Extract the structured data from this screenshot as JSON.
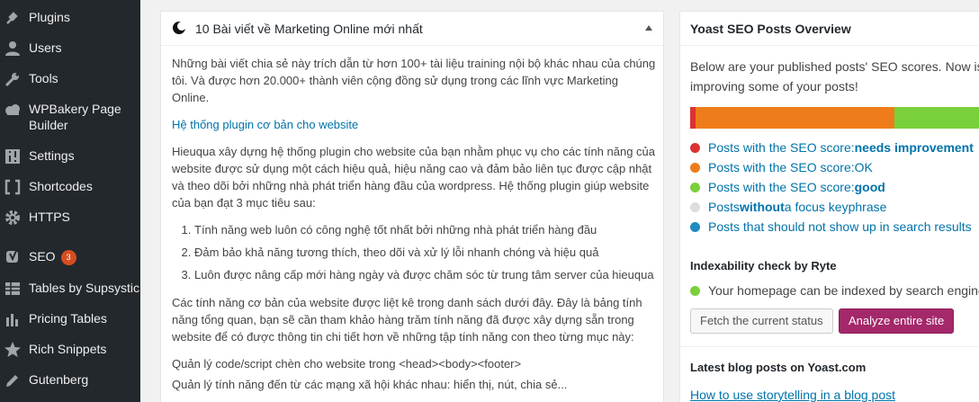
{
  "sidebar": {
    "items": [
      {
        "label": "Plugins",
        "icon": "plug-icon"
      },
      {
        "label": "Users",
        "icon": "user-icon"
      },
      {
        "label": "Tools",
        "icon": "wrench-icon"
      },
      {
        "label": "WPBakery Page Builder",
        "icon": "cloud-icon"
      },
      {
        "label": "Settings",
        "icon": "settings-icon"
      },
      {
        "label": "Shortcodes",
        "icon": "brackets-icon"
      },
      {
        "label": "HTTPS",
        "icon": "gear-icon"
      },
      {
        "label": "SEO",
        "icon": "yoast-icon",
        "badge": "3"
      },
      {
        "label": "Tables by Supsystic",
        "icon": "table-icon"
      },
      {
        "label": "Pricing Tables",
        "icon": "bar-chart-icon"
      },
      {
        "label": "Rich Snippets",
        "icon": "star-icon"
      },
      {
        "label": "Gutenberg",
        "icon": "pencil-icon"
      }
    ]
  },
  "marketing_panel": {
    "title": "10 Bài viết về Marketing Online mới nhất",
    "intro": "Những bài viết chia sẻ này trích dẫn từ hơn 100+ tài liệu training nội bộ khác nhau của chúng tôi. Và được hơn 20.000+ thành viên cộng đồng sử dụng trong các lĩnh vực Marketing Online.",
    "link": "Hệ thống plugin cơ bản cho website",
    "para2": "Hieuqua xây dựng hệ thống plugin cho website của bạn nhằm phục vụ cho các tính năng của website được sử dụng một cách hiệu quả, hiệu năng cao và đảm bảo liên tục được cập nhật và theo dõi bởi những nhà phát triển hàng đầu của wordpress. Hệ thống plugin giúp website của bạn đạt 3 mục tiêu sau:",
    "list": [
      "Tính năng web luôn có công nghệ tốt nhất bởi những nhà phát triển hàng đầu",
      "Đảm bảo khả năng tương thích, theo dõi và xử lý lỗi nhanh chóng và hiệu quả",
      "Luôn được nâng cấp mới hàng ngày và được chăm sóc từ trung tâm server của hieuqua"
    ],
    "para3": "Các tính năng cơ bản của website được liệt kê trong danh sách dưới đây. Đây là bảng tính năng tổng quan, bạn sẽ cần tham khảo hàng trăm tính năng đã được xây dựng sẵn trong website để có được thông tin chi tiết hơn về những tập tính năng con theo từng mục này:",
    "line4": "Quản lý code/script chèn cho website trong <head><body><footer>",
    "line5": "Quản lý tính năng đến từ các mạng xã hội khác nhau: hiển thị, nút, chia sẻ..."
  },
  "yoast_panel": {
    "title": "Yoast SEO Posts Overview",
    "intro": "Below are your published posts' SEO scores. Now is improving some of your posts!",
    "bar_segments": [
      {
        "color": "#dc3232",
        "fraction": 0.018
      },
      {
        "color": "#ee7c1b",
        "fraction": 0.67
      },
      {
        "color": "#7ad03a",
        "fraction": 0.312
      }
    ],
    "legend": [
      {
        "prefix": "Posts with the SEO score: ",
        "strong": "needs improvement",
        "suffix": "",
        "color": "#dc3232"
      },
      {
        "prefix": "Posts with the SEO score: ",
        "strong": "OK",
        "suffix": "",
        "color": "#ee7c1b"
      },
      {
        "prefix": "Posts with the SEO score: ",
        "strong": "good",
        "suffix": "",
        "color": "#7ad03a"
      },
      {
        "prefix": "Posts ",
        "strong": "without",
        "suffix": " a focus keyphrase",
        "color": "#dddddd"
      },
      {
        "prefix": "Posts that should not show up in search results",
        "strong": "",
        "suffix": "",
        "color": "#1e8cbe"
      }
    ],
    "indexability_title": "Indexability check by Ryte",
    "indexability_status": "Your homepage can be indexed by search engine",
    "fetch_button": "Fetch the current status",
    "analyze_button": "Analyze entire site",
    "blog_title": "Latest blog posts on Yoast.com",
    "blog_link": "How to use storytelling in a blog post"
  }
}
